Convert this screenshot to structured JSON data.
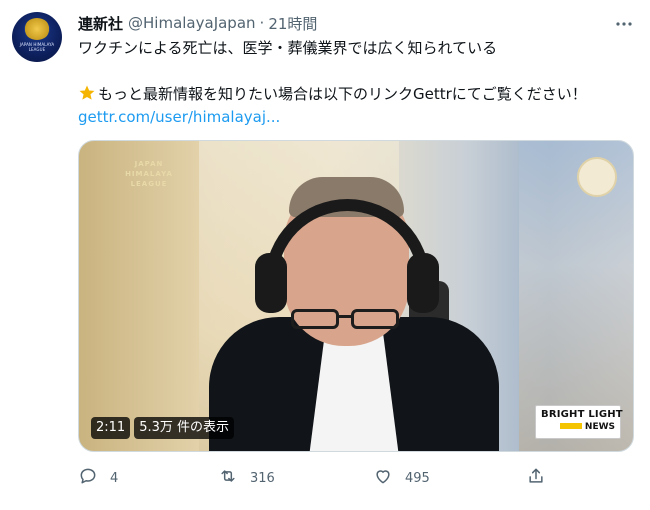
{
  "tweet": {
    "author_name": "連新社",
    "handle": "@HimalayaJapan",
    "separator": "·",
    "time": "21時間",
    "text_line1": "ワクチンによる死亡は、医学・葬儀業界では広く知られている",
    "text_line2": "もっと最新情報を知りたい場合は以下のリンクGettrにてご覧ください！",
    "link_text": "gettr.com/user/himalayaj...",
    "avatar_text": "JAPAN HIMALAYA LEAGUE"
  },
  "media": {
    "watermark": "JAPAN HIMALAYA LEAGUE",
    "duration": "2:11",
    "views": "5.3万 件の表示",
    "brand_line1": "BRIGHT LIGHT",
    "brand_line2": "NEWS"
  },
  "actions": {
    "reply_count": "4",
    "retweet_count": "316",
    "like_count": "495"
  },
  "colors": {
    "link": "#1d9bf0",
    "secondary_text": "#536471"
  }
}
